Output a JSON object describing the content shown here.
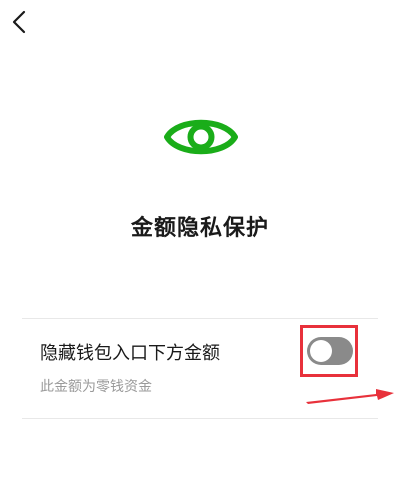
{
  "page": {
    "title": "金额隐私保护"
  },
  "icons": {
    "back": "chevron-left-icon",
    "hero": "eye-icon",
    "accent_color": "#1aad19"
  },
  "setting": {
    "label": "隐藏钱包入口下方金额",
    "subtitle": "此金额为零钱资金",
    "toggle_on": false
  },
  "annotation": {
    "color": "#e8313b"
  }
}
